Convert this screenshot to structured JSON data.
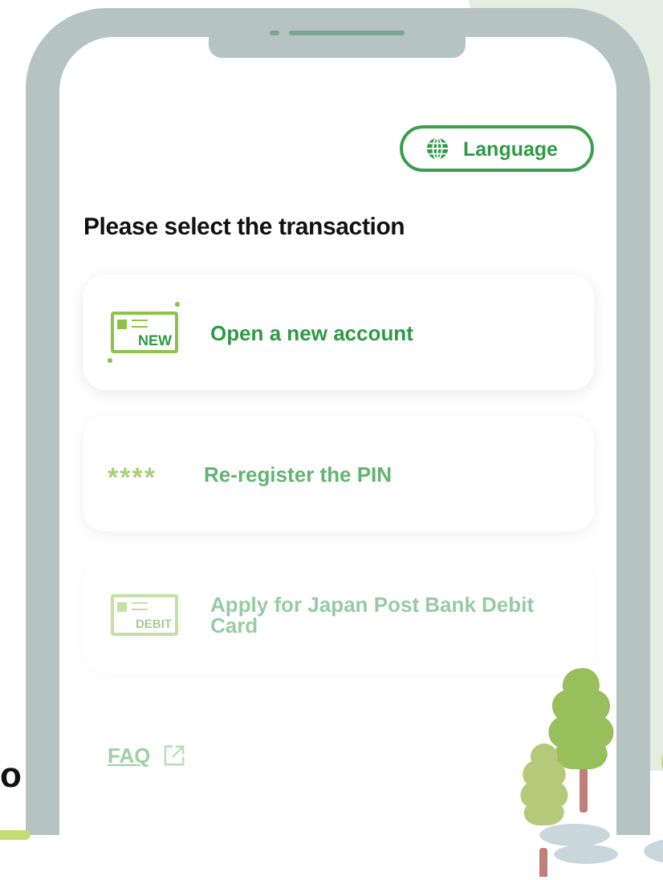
{
  "language_button": {
    "label": "Language"
  },
  "heading": "Please select the transaction",
  "transactions": [
    {
      "kind": "new",
      "icon_label": "NEW",
      "label": "Open a new account"
    },
    {
      "kind": "pin",
      "icon_label": "****",
      "label": "Re-register the PIN"
    },
    {
      "kind": "debit",
      "icon_label": "DEBIT",
      "label": "Apply for Japan Post Bank Debit Card"
    }
  ],
  "links": [
    {
      "label": "FAQ"
    }
  ],
  "side_text": "o"
}
